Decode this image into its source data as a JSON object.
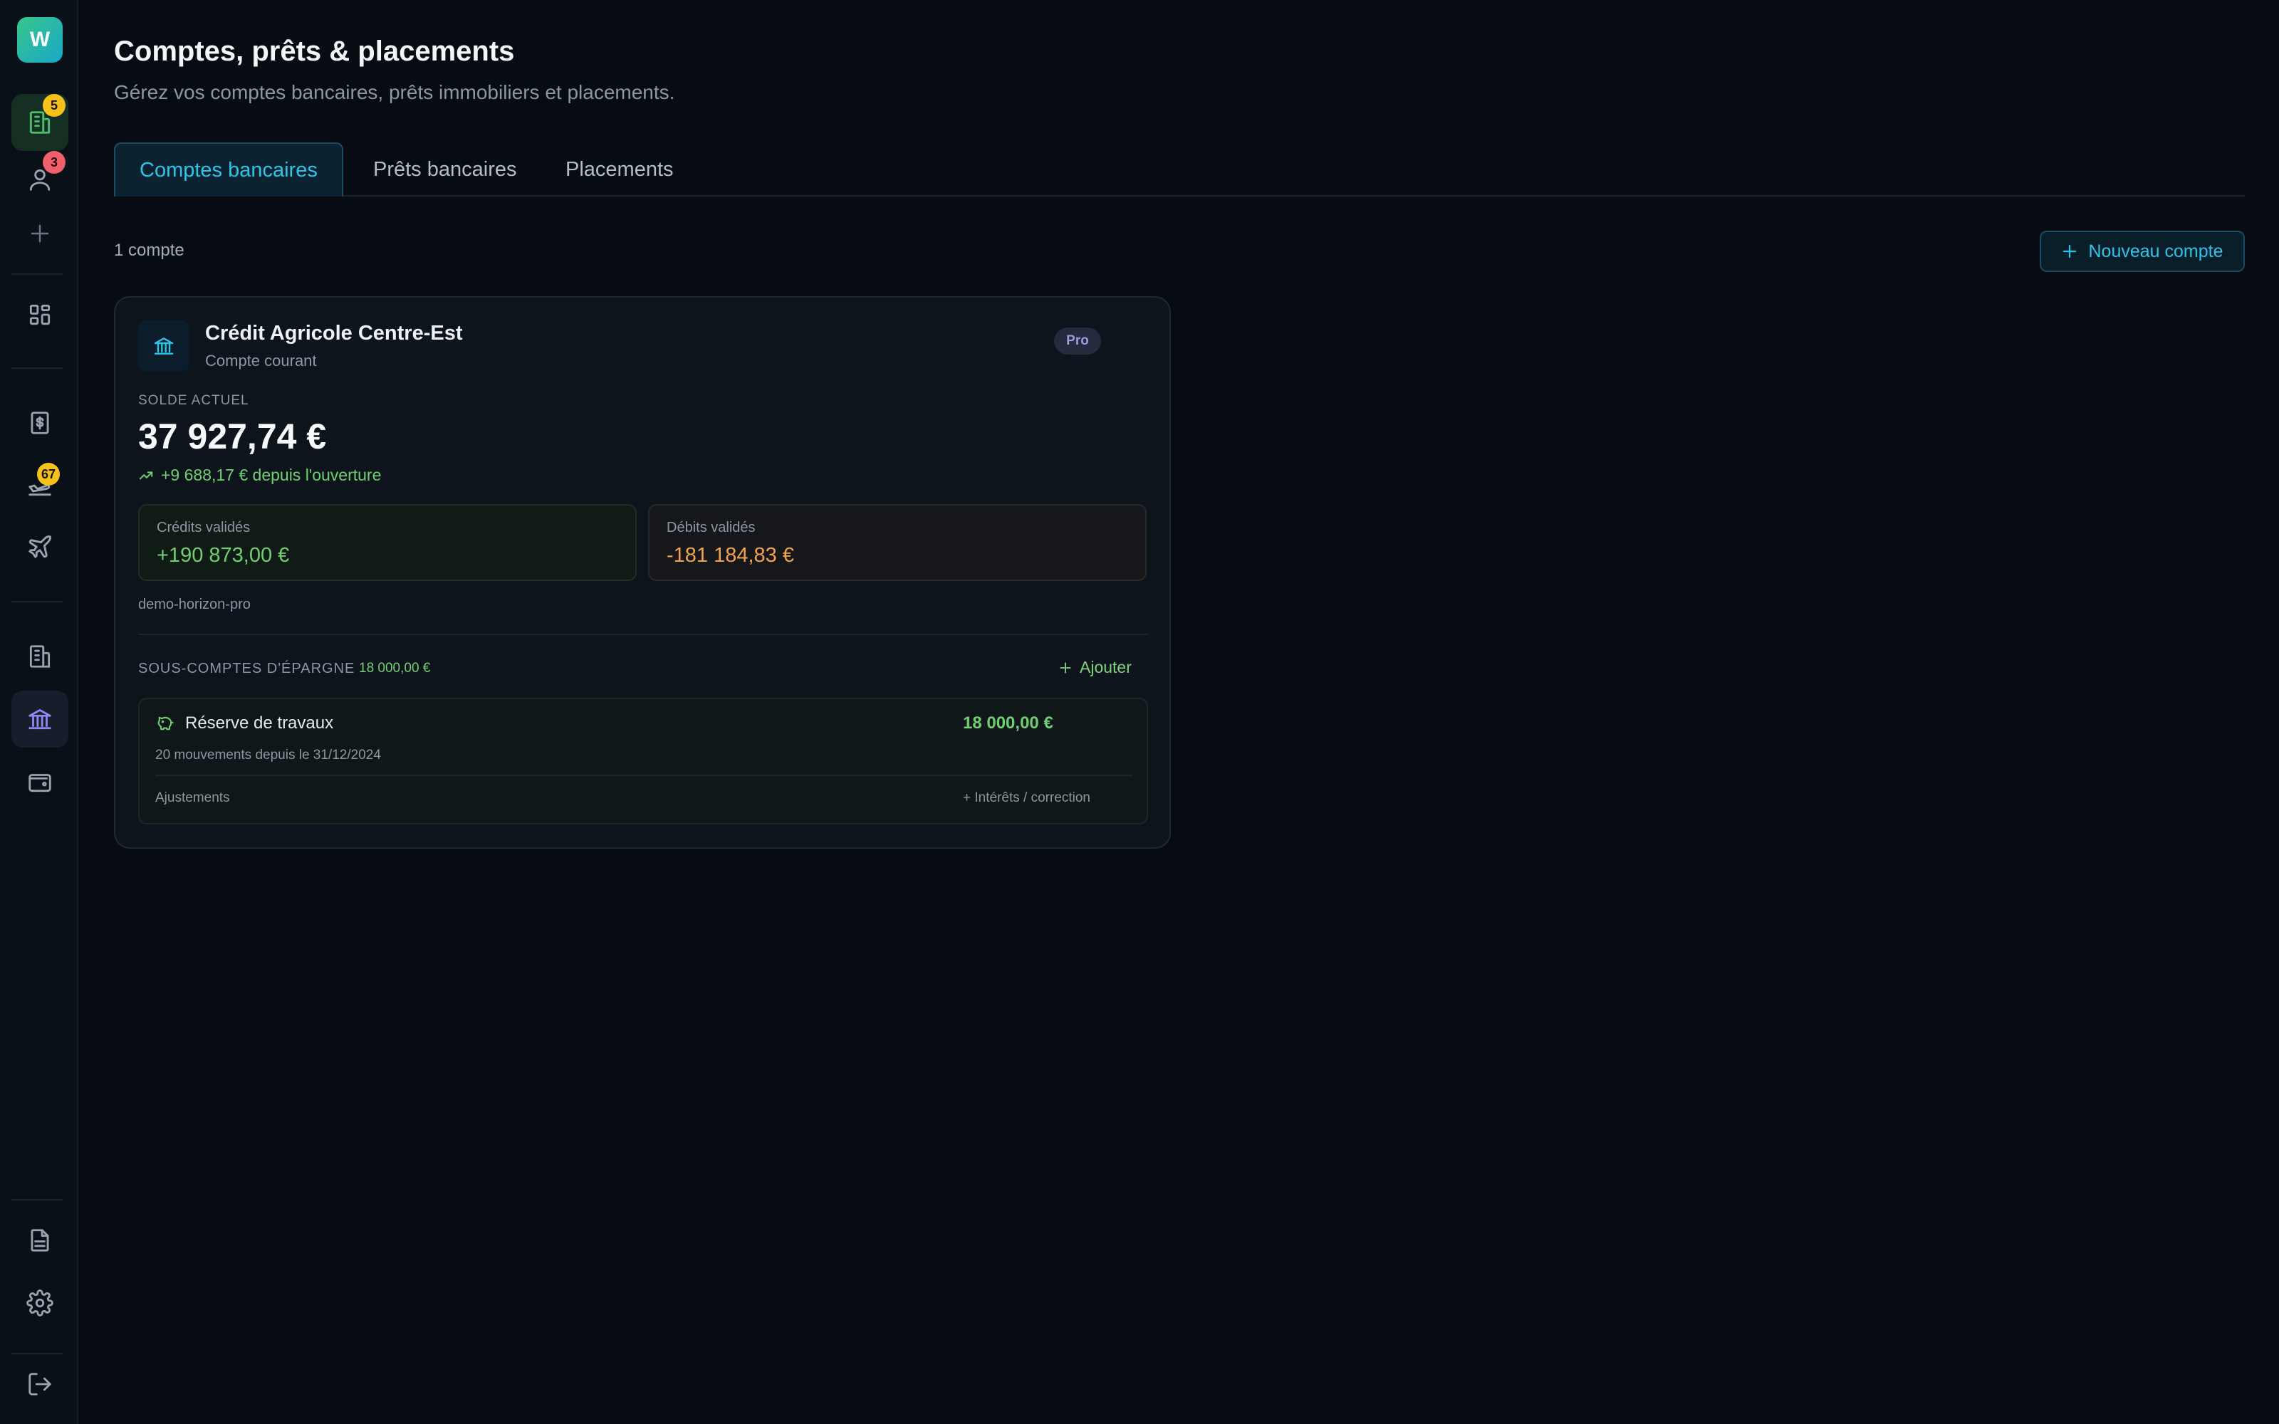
{
  "sidebar": {
    "logo_letter": "W",
    "badges": {
      "buildings": "5",
      "clients": "3",
      "flights": "67"
    }
  },
  "header": {
    "title": "Comptes, prêts & placements",
    "subtitle": "Gérez vos comptes bancaires, prêts immobiliers et placements."
  },
  "tabs": [
    {
      "label": "Comptes bancaires",
      "active": true
    },
    {
      "label": "Prêts bancaires",
      "active": false
    },
    {
      "label": "Placements",
      "active": false
    }
  ],
  "toolbar": {
    "count_label": "1 compte",
    "new_account_label": "Nouveau compte"
  },
  "account": {
    "bank_name": "Crédit Agricole Centre-Est",
    "account_type": "Compte courant",
    "tag": "Pro",
    "balance_label": "SOLDE ACTUEL",
    "balance": "37 927,74 €",
    "trend_text": "+9 688,17 € depuis l'ouverture",
    "credits_label": "Crédits validés",
    "credits_value": "+190 873,00 €",
    "debits_label": "Débits validés",
    "debits_value": "-181 184,83 €",
    "slug": "demo-horizon-pro",
    "savings_title": "SOUS-COMPTES D'ÉPARGNE",
    "savings_total": "18 000,00 €",
    "add_label": "Ajouter",
    "sub_accounts": [
      {
        "name": "Réserve de travaux",
        "amount": "18 000,00 €",
        "movements": "20 mouvements depuis le 31/12/2024",
        "adjust_label": "Ajustements",
        "adjust_action": "+ Intérêts / correction"
      }
    ]
  },
  "colors": {
    "background": "#070c13",
    "accent": "#2cc5ea",
    "positive": "#6fd071",
    "negative": "#f2a24c",
    "badge_yellow": "#f4c21a",
    "badge_red": "#f0606a"
  }
}
